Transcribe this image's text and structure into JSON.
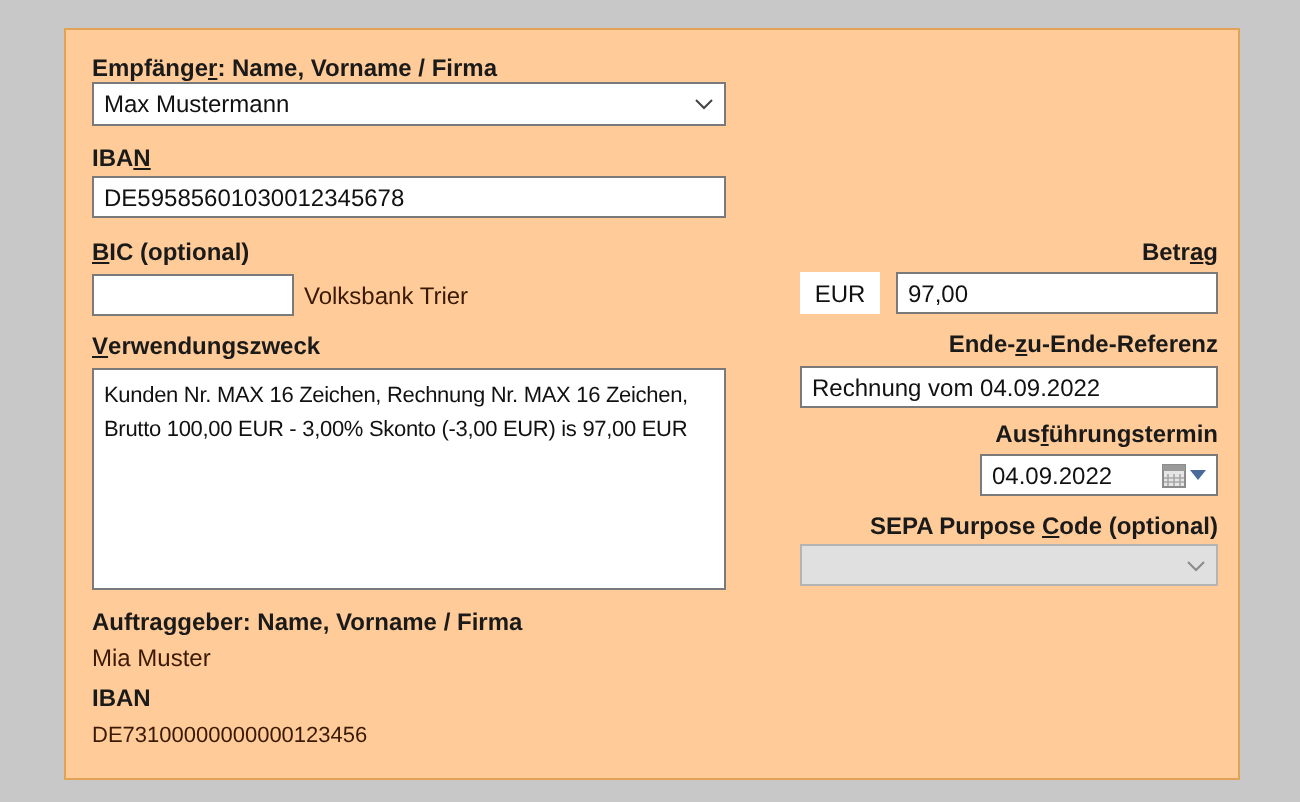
{
  "recipient": {
    "label": [
      {
        "text": "Empfänge",
        "underlined": false
      },
      {
        "text": "r",
        "underlined": true
      },
      {
        "text": ": Name, Vorname / Firma",
        "underlined": false
      }
    ],
    "field": {
      "kind": "combo",
      "value": "Max Mustermann",
      "disabled": false
    }
  },
  "iban": {
    "label": [
      {
        "text": "IBA",
        "underlined": false
      },
      {
        "text": "N",
        "underlined": true
      }
    ],
    "field": {
      "kind": "text",
      "value": "DE59585601030012345678"
    }
  },
  "bic": {
    "label": [
      {
        "text": "B",
        "underlined": true
      },
      {
        "text": "IC (optional)",
        "underlined": false
      }
    ],
    "field": {
      "kind": "text"
    },
    "bank_name": "Volksbank Trier"
  },
  "amount": {
    "label": [
      {
        "text": "Betr",
        "underlined": false
      },
      {
        "text": "a",
        "underlined": true
      },
      {
        "text": "g",
        "underlined": false
      }
    ],
    "currency": "EUR",
    "field": {
      "kind": "text",
      "value": "97,00"
    }
  },
  "purpose": {
    "label": [
      {
        "text": "V",
        "underlined": true
      },
      {
        "text": "erwendungszweck",
        "underlined": false
      }
    ],
    "field": {
      "kind": "textarea",
      "value": "Kunden Nr. MAX 16 Zeichen, Rechnung Nr. MAX 16 Zeichen, Brutto 100,00 EUR - 3,00% Skonto (-3,00 EUR) is 97,00 EUR"
    }
  },
  "end_to_end_reference": {
    "label": [
      {
        "text": "Ende-",
        "underlined": false
      },
      {
        "text": "z",
        "underlined": true
      },
      {
        "text": "u-Ende-Referenz",
        "underlined": false
      }
    ],
    "field": {
      "kind": "text",
      "value": "Rechnung vom 04.09.2022"
    }
  },
  "execution_date": {
    "label": [
      {
        "text": "Aus",
        "underlined": false
      },
      {
        "text": "f",
        "underlined": true
      },
      {
        "text": "ührungstermin",
        "underlined": false
      }
    ],
    "field": {
      "kind": "date",
      "value": "04.09.2022"
    }
  },
  "sepa_purpose_code": {
    "label": [
      {
        "text": "SEPA Purpose ",
        "underlined": false
      },
      {
        "text": "C",
        "underlined": true
      },
      {
        "text": "ode (optional)",
        "underlined": false
      }
    ],
    "field": {
      "kind": "combo",
      "disabled": true
    }
  },
  "originator": {
    "name_label": "Auftraggeber: Name, Vorname / Firma",
    "name": "Mia Muster",
    "iban_label": "IBAN",
    "iban": "DE73100000000000123456"
  }
}
